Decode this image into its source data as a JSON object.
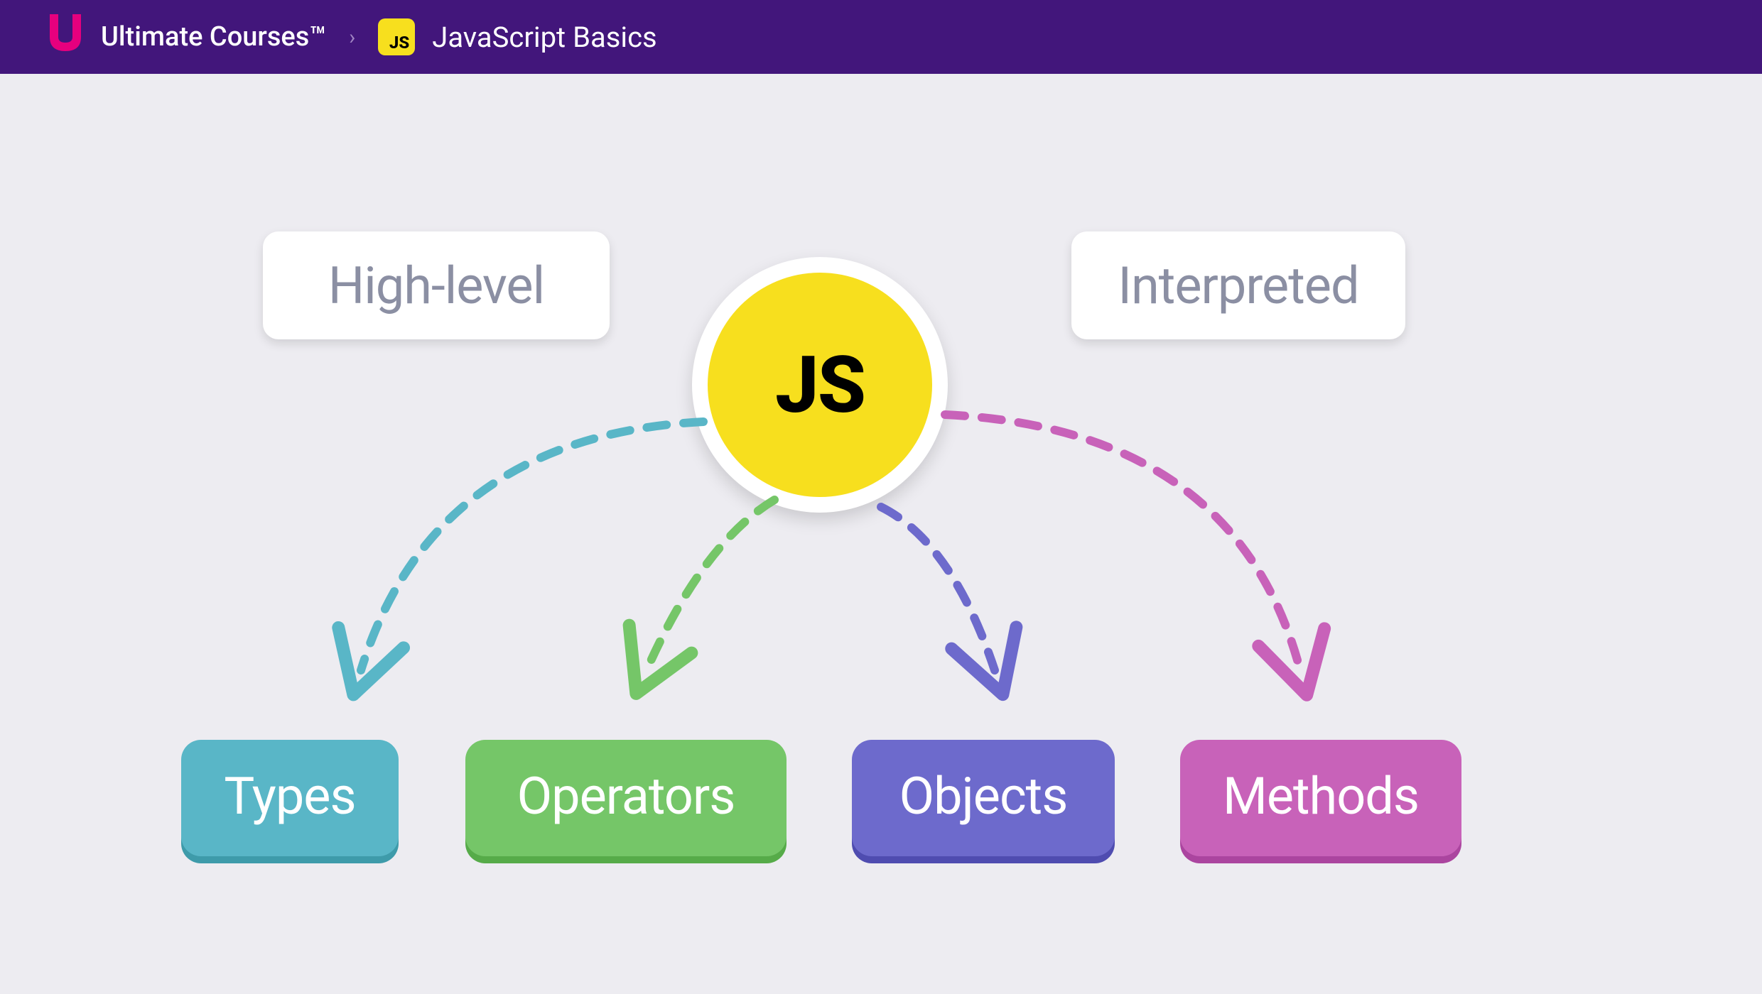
{
  "header": {
    "brand": "Ultimate Courses™",
    "badge": "JS",
    "course": "JavaScript Basics"
  },
  "diagram": {
    "center_label": "JS",
    "characteristics": [
      {
        "name": "high-level",
        "label": "High-level"
      },
      {
        "name": "interpreted",
        "label": "Interpreted"
      }
    ],
    "categories": [
      {
        "name": "types",
        "label": "Types",
        "color": "#59b6c7"
      },
      {
        "name": "operators",
        "label": "Operators",
        "color": "#75c668"
      },
      {
        "name": "objects",
        "label": "Objects",
        "color": "#6d6acc"
      },
      {
        "name": "methods",
        "label": "Methods",
        "color": "#c862b9"
      }
    ]
  }
}
